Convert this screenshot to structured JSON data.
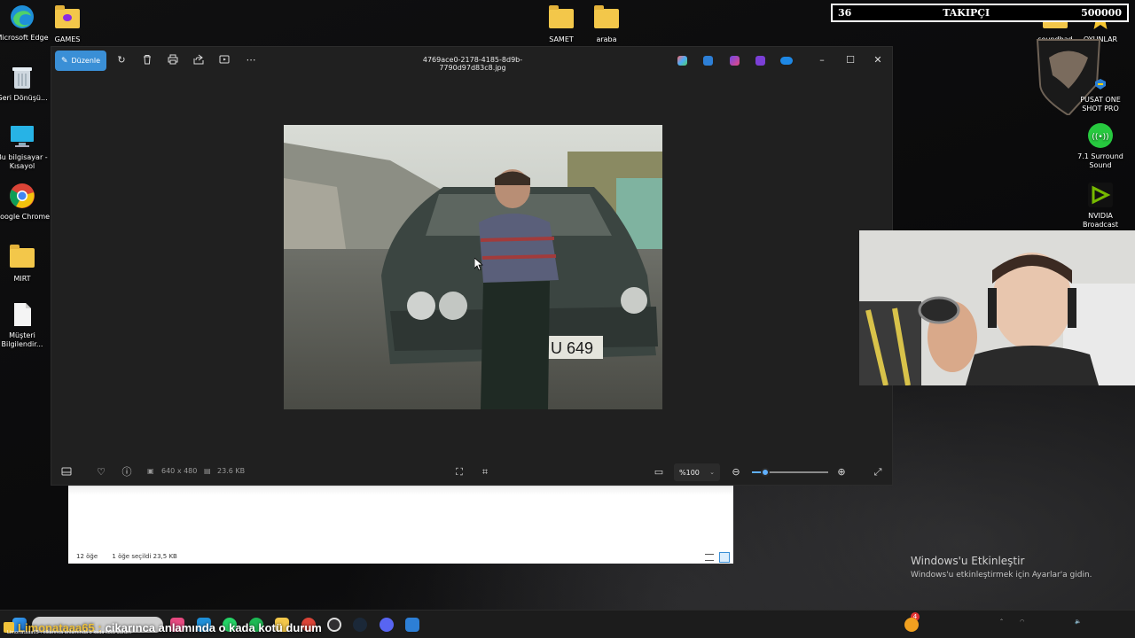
{
  "desktop": {
    "left_icons": [
      {
        "label": "Microsoft Edge",
        "icon": "edge-icon"
      },
      {
        "label": "Geri Dönüşü...",
        "icon": "recycle-bin-icon"
      },
      {
        "label": "Bu bilgisayar - Kısayol",
        "icon": "this-pc-icon"
      },
      {
        "label": "Google Chrome",
        "icon": "chrome-icon"
      },
      {
        "label": "MIRT",
        "icon": "folder-icon"
      },
      {
        "label": "Müşteri Bilgilendir...",
        "icon": "document-icon"
      }
    ],
    "top_icons": [
      {
        "label": "GAMES",
        "icon": "folder-icon"
      },
      {
        "label": "SAMET",
        "icon": "folder-icon"
      },
      {
        "label": "araba",
        "icon": "folder-icon"
      }
    ],
    "right_icons": [
      {
        "label": "soundbad",
        "icon": "folder-icon"
      },
      {
        "label": "OYUNLAR",
        "icon": "star-icon"
      },
      {
        "label": "PUSAT ONE SHOT PRO",
        "icon": "msi-dragon-icon"
      },
      {
        "label": "7.1 Surround Sound",
        "icon": "surround-icon"
      },
      {
        "label": "NVIDIA Broadcast",
        "icon": "nvidia-icon"
      }
    ]
  },
  "follower_bar": {
    "current": "36",
    "label": "TAKIPÇI",
    "goal": "500000"
  },
  "photos": {
    "edit_label": "Düzenle",
    "filename": "4769ace0-2178-4185-8d9b-7790d97d83c8.jpg",
    "dimensions": "640 x 480",
    "file_size": "23.6 KB",
    "zoom": "%100",
    "zoom_level": 0.18
  },
  "explorer": {
    "item_count": "12 öğe",
    "selection": "1 öğe seçildi  23,5 KB"
  },
  "activation": {
    "title": "Windows'u Etkinleştir",
    "subtitle": "Windows'u etkinleştirmek için Ayarlar'a gidin."
  },
  "chat": {
    "user": "Limonataaa65 :",
    "message": "cikarınca anlamında o kada kotü durum",
    "sub": "Limonataaa65 : cikarınca anlamında o kada kotü durum"
  },
  "taskbar": {
    "notification_count": "4"
  }
}
